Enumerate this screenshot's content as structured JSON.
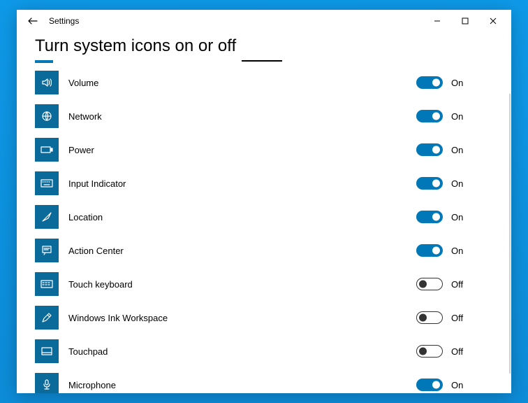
{
  "window": {
    "title": "Settings"
  },
  "page": {
    "heading": "Turn system icons on or off"
  },
  "toggleLabels": {
    "on": "On",
    "off": "Off"
  },
  "items": [
    {
      "id": "volume",
      "label": "Volume",
      "state": "on",
      "icon": "volume-icon"
    },
    {
      "id": "network",
      "label": "Network",
      "state": "on",
      "icon": "globe-icon"
    },
    {
      "id": "power",
      "label": "Power",
      "state": "on",
      "icon": "battery-icon"
    },
    {
      "id": "input",
      "label": "Input Indicator",
      "state": "on",
      "icon": "keyboard-icon"
    },
    {
      "id": "location",
      "label": "Location",
      "state": "on",
      "icon": "location-icon"
    },
    {
      "id": "actioncenter",
      "label": "Action Center",
      "state": "on",
      "icon": "action-center-icon"
    },
    {
      "id": "touchkb",
      "label": "Touch keyboard",
      "state": "off",
      "icon": "touch-keyboard-icon"
    },
    {
      "id": "ink",
      "label": "Windows Ink Workspace",
      "state": "off",
      "icon": "pen-icon"
    },
    {
      "id": "touchpad",
      "label": "Touchpad",
      "state": "off",
      "icon": "touchpad-icon"
    },
    {
      "id": "microphone",
      "label": "Microphone",
      "state": "on",
      "icon": "microphone-icon"
    }
  ]
}
